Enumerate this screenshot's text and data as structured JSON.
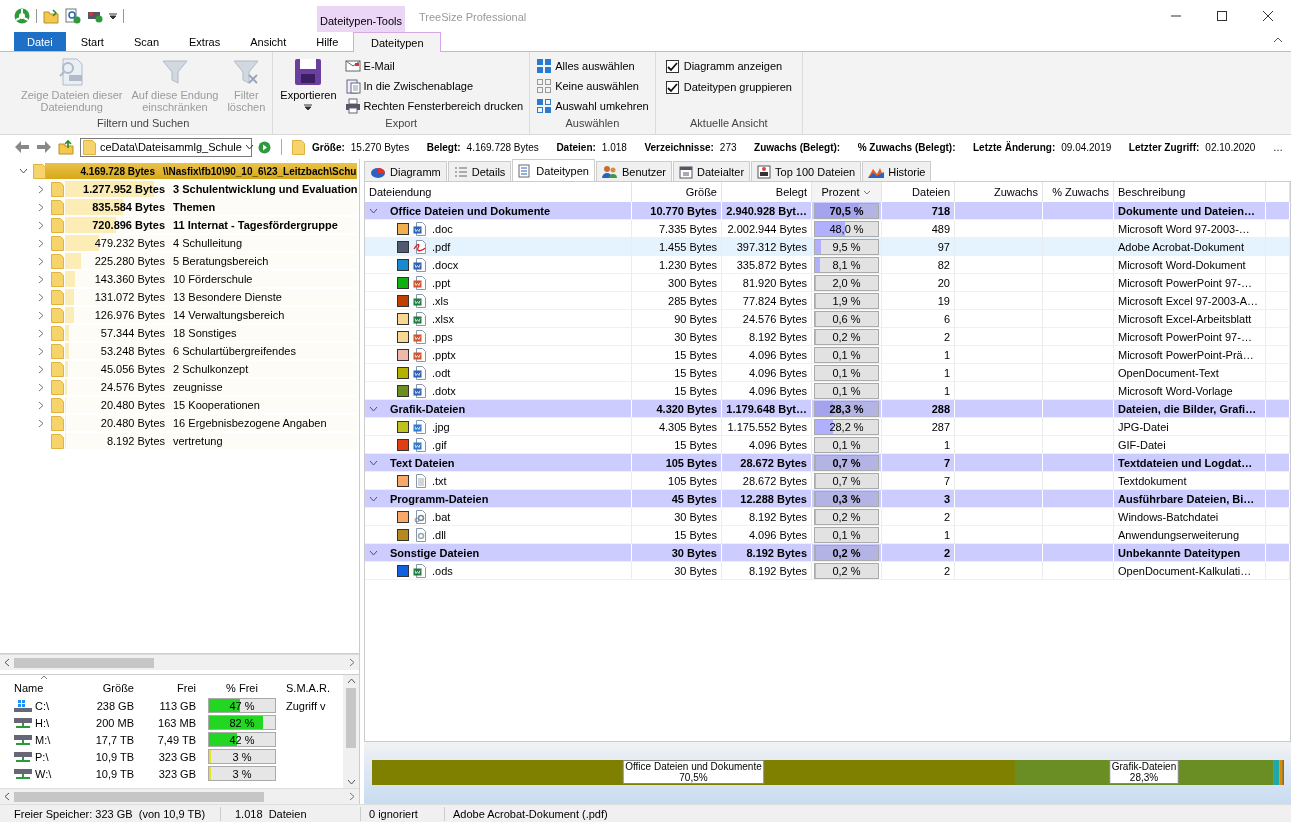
{
  "title_bar": {
    "context_group": "Dateitypen-Tools",
    "title": "TreeSize Professional"
  },
  "ribbon_tabs": [
    {
      "label": "Datei",
      "kind": "file",
      "selected": false
    },
    {
      "label": "Start",
      "kind": "normal",
      "selected": false
    },
    {
      "label": "Scan",
      "kind": "normal",
      "selected": false
    },
    {
      "label": "Extras",
      "kind": "normal",
      "selected": false
    },
    {
      "label": "Ansicht",
      "kind": "normal",
      "selected": false
    },
    {
      "label": "Hilfe",
      "kind": "normal",
      "selected": false
    },
    {
      "label": "Dateitypen",
      "kind": "context",
      "selected": true
    }
  ],
  "ribbon_groups": [
    {
      "title": "Filtern und Suchen",
      "items": [
        {
          "kind": "large",
          "label": "Zeige Dateien dieser\nDateiendung",
          "disabled": true
        },
        {
          "kind": "large",
          "label": "Auf diese Endung\neinschränken",
          "disabled": true
        },
        {
          "kind": "large",
          "label": "Filter\nlöschen",
          "disabled": true
        }
      ]
    },
    {
      "title": "Export",
      "items": [
        {
          "kind": "large",
          "label": "Exportieren",
          "disabled": false,
          "dropdown": true
        },
        {
          "kind": "small",
          "label": "E-Mail"
        },
        {
          "kind": "small",
          "label": "In die Zwischenablage"
        },
        {
          "kind": "small",
          "label": "Rechten Fensterbereich drucken"
        }
      ]
    },
    {
      "title": "Auswählen",
      "items": [
        {
          "kind": "small",
          "label": "Alles auswählen"
        },
        {
          "kind": "small",
          "label": "Keine auswählen"
        },
        {
          "kind": "small",
          "label": "Auswahl umkehren"
        }
      ]
    },
    {
      "title": "Aktuelle Ansicht",
      "items": [
        {
          "kind": "check",
          "label": "Diagramm anzeigen",
          "checked": true
        },
        {
          "kind": "check",
          "label": "Dateitypen gruppieren",
          "checked": true
        }
      ]
    }
  ],
  "path_bar": {
    "path": "ceData\\Dateisammlg_Schule",
    "stats": [
      {
        "label": "Größe:",
        "value": "15.270 Bytes"
      },
      {
        "label": "Belegt:",
        "value": "4.169.728 Bytes"
      },
      {
        "label": "Dateien:",
        "value": "1.018"
      },
      {
        "label": "Verzeichnisse:",
        "value": "273"
      },
      {
        "label": "Zuwachs (Belegt):"
      },
      {
        "label": "% Zuwachs (Belegt):"
      },
      {
        "label": "Letzte Änderung:",
        "value": "09.04.2019"
      },
      {
        "label": "Letzter Zugriff:",
        "value": "02.10.2020"
      }
    ],
    "more": "…"
  },
  "tree": [
    {
      "size": "4.169.728 Bytes",
      "name": "\\\\Nasfix\\fb10\\90_10_6\\23_Leitzbach\\Schu",
      "expandable": true,
      "expanded": true,
      "highlighted": true,
      "level": 1,
      "children": [
        {
          "size": "1.277.952 Bytes",
          "name": "3 Schulentwicklung und Evaluation",
          "expandable": true,
          "expanded": false,
          "highlighted": true,
          "level": 0.306
        },
        {
          "size": "835.584 Bytes",
          "name": "Themen",
          "expandable": true,
          "expanded": false,
          "highlighted": true,
          "level": 0.2
        },
        {
          "size": "720.896 Bytes",
          "name": "11 Internat - Tagesfördergruppe",
          "expandable": true,
          "expanded": false,
          "highlighted": true,
          "level": 0.173
        },
        {
          "size": "479.232 Bytes",
          "name": "4 Schulleitung",
          "expandable": true,
          "expanded": false,
          "highlighted": false,
          "level": 0.115
        },
        {
          "size": "225.280 Bytes",
          "name": "5 Beratungsbereich",
          "expandable": true,
          "expanded": false,
          "highlighted": false,
          "level": 0.054
        },
        {
          "size": "143.360 Bytes",
          "name": "10 Förderschule",
          "expandable": true,
          "expanded": false,
          "highlighted": false,
          "level": 0.034
        },
        {
          "size": "131.072 Bytes",
          "name": "13 Besondere Dienste",
          "expandable": true,
          "expanded": false,
          "highlighted": false,
          "level": 0.031
        },
        {
          "size": "126.976 Bytes",
          "name": "14 Verwaltungsbereich",
          "expandable": true,
          "expanded": false,
          "highlighted": false,
          "level": 0.03
        },
        {
          "size": "57.344 Bytes",
          "name": "18 Sonstiges",
          "expandable": true,
          "expanded": false,
          "highlighted": false,
          "level": 0.014
        },
        {
          "size": "53.248 Bytes",
          "name": "6 Schulartübergreifendes",
          "expandable": true,
          "expanded": false,
          "highlighted": false,
          "level": 0.013
        },
        {
          "size": "45.056 Bytes",
          "name": "2 Schulkonzept",
          "expandable": true,
          "expanded": false,
          "highlighted": false,
          "level": 0.011
        },
        {
          "size": "24.576 Bytes",
          "name": "zeugnisse",
          "expandable": true,
          "expanded": false,
          "highlighted": false,
          "level": 0.006
        },
        {
          "size": "20.480 Bytes",
          "name": "15 Kooperationen",
          "expandable": true,
          "expanded": false,
          "highlighted": false,
          "level": 0.005
        },
        {
          "size": "20.480 Bytes",
          "name": "16 Ergebnisbezogene Angaben",
          "expandable": true,
          "expanded": false,
          "highlighted": false,
          "level": 0.005
        },
        {
          "size": "8.192 Bytes",
          "name": "vertretung",
          "expandable": false,
          "expanded": false,
          "highlighted": false,
          "level": 0.002
        }
      ]
    }
  ],
  "drives": {
    "columns": [
      {
        "label": "Name",
        "sorted": true
      },
      {
        "label": "Größe",
        "sorted": false
      },
      {
        "label": "Frei",
        "sorted": false
      },
      {
        "label": "% Frei",
        "sorted": false
      },
      {
        "label": "S.M.A.R.",
        "sorted": false
      }
    ],
    "rows": [
      {
        "kind": "local",
        "name": "C:\\",
        "size": "238 GB",
        "free": "113 GB",
        "percent": "47 %",
        "level": 0.47,
        "smart": "Zugriff v"
      },
      {
        "kind": "network",
        "name": "H:\\",
        "size": "200 MB",
        "free": "163 MB",
        "percent": "82 %",
        "level": 0.82
      },
      {
        "kind": "network",
        "name": "M:\\",
        "size": "17,7 TB",
        "free": "7,49 TB",
        "percent": "42 %",
        "level": 0.42
      },
      {
        "kind": "network",
        "name": "P:\\",
        "size": "10,9 TB",
        "free": "323 GB",
        "percent": "3 %",
        "level": 0.03
      },
      {
        "kind": "network",
        "name": "W:\\",
        "size": "10,9 TB",
        "free": "323 GB",
        "percent": "3 %",
        "level": 0.03
      }
    ]
  },
  "view_tabs": [
    {
      "label": "Diagramm",
      "selected": false
    },
    {
      "label": "Details",
      "selected": false
    },
    {
      "label": "Dateitypen",
      "selected": true
    },
    {
      "label": "Benutzer",
      "selected": false
    },
    {
      "label": "Dateialter",
      "selected": false
    },
    {
      "label": "Top 100 Dateien",
      "selected": false
    },
    {
      "label": "Historie",
      "selected": false
    }
  ],
  "table": {
    "columns": [
      {
        "label": "Dateiendung",
        "sorted": false
      },
      {
        "label": "Größe",
        "sorted": false
      },
      {
        "label": "Belegt",
        "sorted": false
      },
      {
        "label": "Prozent",
        "sorted": true
      },
      {
        "label": "Dateien",
        "sorted": false
      },
      {
        "label": "Zuwachs",
        "sorted": false
      },
      {
        "label": "% Zuwachs",
        "sorted": false
      },
      {
        "label": "Beschreibung",
        "sorted": false
      }
    ],
    "groups": [
      {
        "name": "Office Dateien und Dokumente",
        "size": "10.770 Bytes",
        "used": "2.940.928 Byt…",
        "percent": "70,5 %",
        "level": 0.705,
        "files": "718",
        "description": "Dokumente und Dateien…",
        "expanded": true,
        "children": [
          {
            "ext": ".doc",
            "color": "#f0b050",
            "kind": "word",
            "size": "7.335 Bytes",
            "used": "2.002.944 Bytes",
            "percent": "48,0 %",
            "level": 0.48,
            "files": "489",
            "description": "Microsoft Word 97-2003-…",
            "selected": false
          },
          {
            "ext": ".pdf",
            "color": "#505a70",
            "kind": "pdf",
            "size": "1.455 Bytes",
            "used": "397.312 Bytes",
            "percent": "9,5 %",
            "level": 0.095,
            "files": "97",
            "description": "Adobe Acrobat-Dokument",
            "selected": true
          },
          {
            "ext": ".docx",
            "color": "#1a8ad0",
            "kind": "word",
            "size": "1.230 Bytes",
            "used": "335.872 Bytes",
            "percent": "8,1 %",
            "level": 0.081,
            "files": "82",
            "description": "Microsoft Word-Dokument",
            "selected": false
          },
          {
            "ext": ".ppt",
            "color": "#10b010",
            "kind": "powerpoint",
            "size": "300 Bytes",
            "used": "81.920 Bytes",
            "percent": "2,0 %",
            "level": 0.02,
            "files": "20",
            "description": "Microsoft PowerPoint 97-…",
            "selected": false
          },
          {
            "ext": ".xls",
            "color": "#c04000",
            "kind": "excel",
            "size": "285 Bytes",
            "used": "77.824 Bytes",
            "percent": "1,9 %",
            "level": 0.019,
            "files": "19",
            "description": "Microsoft Excel 97-2003-A…",
            "selected": false
          },
          {
            "ext": ".xlsx",
            "color": "#f8d890",
            "kind": "excel",
            "size": "90 Bytes",
            "used": "24.576 Bytes",
            "percent": "0,6 %",
            "level": 0.006,
            "files": "6",
            "description": "Microsoft Excel-Arbeitsblatt",
            "selected": false
          },
          {
            "ext": ".pps",
            "color": "#f8d890",
            "kind": "powerpoint",
            "size": "30 Bytes",
            "used": "8.192 Bytes",
            "percent": "0,2 %",
            "level": 0.002,
            "files": "2",
            "description": "Microsoft PowerPoint 97-…",
            "selected": false
          },
          {
            "ext": ".pptx",
            "color": "#f0b8a8",
            "kind": "powerpoint",
            "size": "15 Bytes",
            "used": "4.096 Bytes",
            "percent": "0,1 %",
            "level": 0.001,
            "files": "1",
            "description": "Microsoft PowerPoint-Prä…",
            "selected": false
          },
          {
            "ext": ".odt",
            "color": "#b8b000",
            "kind": "word",
            "size": "15 Bytes",
            "used": "4.096 Bytes",
            "percent": "0,1 %",
            "level": 0.001,
            "files": "1",
            "description": "OpenDocument-Text",
            "selected": false
          },
          {
            "ext": ".dotx",
            "color": "#6b8e23",
            "kind": "word",
            "size": "15 Bytes",
            "used": "4.096 Bytes",
            "percent": "0,1 %",
            "level": 0.001,
            "files": "1",
            "description": "Microsoft Word-Vorlage",
            "selected": false
          }
        ]
      },
      {
        "name": "Grafik-Dateien",
        "size": "4.320 Bytes",
        "used": "1.179.648 Byt…",
        "percent": "28,3 %",
        "level": 0.283,
        "files": "288",
        "description": "Dateien, die Bilder, Grafi…",
        "expanded": true,
        "children": [
          {
            "ext": ".jpg",
            "color": "#c0c020",
            "kind": "image",
            "size": "4.305 Bytes",
            "used": "1.175.552 Bytes",
            "percent": "28,2 %",
            "level": 0.282,
            "files": "287",
            "description": "JPG-Datei",
            "selected": false
          },
          {
            "ext": ".gif",
            "color": "#e04010",
            "kind": "image",
            "size": "15 Bytes",
            "used": "4.096 Bytes",
            "percent": "0,1 %",
            "level": 0.001,
            "files": "1",
            "description": "GIF-Datei",
            "selected": false
          }
        ]
      },
      {
        "name": "Text Dateien",
        "size": "105 Bytes",
        "used": "28.672 Bytes",
        "percent": "0,7 %",
        "level": 0.007,
        "files": "7",
        "description": "Textdateien und Logdat…",
        "expanded": true,
        "children": [
          {
            "ext": ".txt",
            "color": "#f8a868",
            "kind": "text",
            "size": "105 Bytes",
            "used": "28.672 Bytes",
            "percent": "0,7 %",
            "level": 0.007,
            "files": "7",
            "description": "Textdokument",
            "selected": false
          }
        ]
      },
      {
        "name": "Programm-Dateien",
        "size": "45 Bytes",
        "used": "12.288 Bytes",
        "percent": "0,3 %",
        "level": 0.003,
        "files": "3",
        "description": "Ausführbare Dateien, Bi…",
        "expanded": true,
        "children": [
          {
            "ext": ".bat",
            "color": "#f8a868",
            "kind": "batch",
            "size": "30 Bytes",
            "used": "8.192 Bytes",
            "percent": "0,2 %",
            "level": 0.002,
            "files": "2",
            "description": "Windows-Batchdatei",
            "selected": false
          },
          {
            "ext": ".dll",
            "color": "#b88820",
            "kind": "library",
            "size": "15 Bytes",
            "used": "4.096 Bytes",
            "percent": "0,1 %",
            "level": 0.001,
            "files": "1",
            "description": "Anwendungserweiterung",
            "selected": false
          }
        ]
      },
      {
        "name": "Sonstige Dateien",
        "size": "30 Bytes",
        "used": "8.192 Bytes",
        "percent": "0,2 %",
        "level": 0.002,
        "files": "2",
        "description": "Unbekannte Dateitypen",
        "expanded": true,
        "children": [
          {
            "ext": ".ods",
            "color": "#1060e0",
            "kind": "excel",
            "size": "30 Bytes",
            "used": "8.192 Bytes",
            "percent": "0,2 %",
            "level": 0.002,
            "files": "2",
            "description": "OpenDocument-Kalkulati…",
            "selected": false
          }
        ]
      }
    ]
  },
  "distribution_chart": {
    "chart_data": {
      "type": "bar",
      "orientation": "horizontal",
      "stacked": true,
      "series": [
        {
          "name": "Office Dateien und Dokumente",
          "color": "#7f7f00",
          "values": [
            70.5
          ],
          "value_labels": [
            "70,5%"
          ]
        },
        {
          "name": "Grafik-Dateien",
          "color": "#6a8e24",
          "values": [
            28.3
          ],
          "value_labels": [
            "28,3%"
          ]
        },
        {
          "color": "#20a8a8",
          "values": [
            0.7
          ],
          "value_labels": [
            null
          ]
        },
        {
          "color": "#e08a00",
          "values": [
            0.3
          ],
          "value_labels": [
            null
          ]
        },
        {
          "color": "#9a6a10",
          "values": [
            0.2
          ],
          "value_labels": [
            null
          ]
        }
      ]
    }
  },
  "status_bar": {
    "left": [
      "Freier Speicher: 323 GB  (von 10,9 TB)",
      "1.018  Dateien"
    ],
    "right": [
      "0 ignoriert",
      "Adobe Acrobat-Dokument (.pdf)"
    ]
  }
}
